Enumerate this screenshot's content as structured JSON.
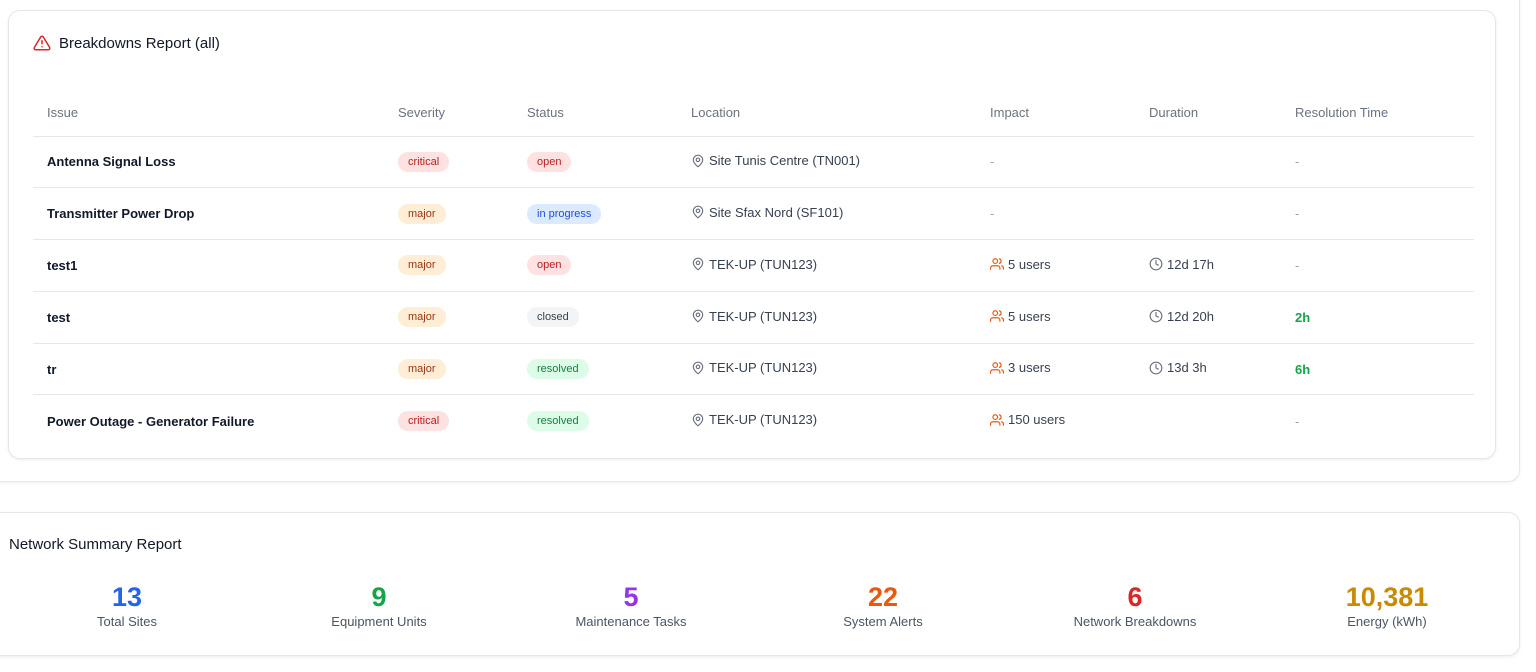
{
  "breakdowns": {
    "title": "Breakdowns Report (all)",
    "columns": [
      "Issue",
      "Severity",
      "Status",
      "Location",
      "Impact",
      "Duration",
      "Resolution Time"
    ],
    "rows": [
      {
        "issue": "Antenna Signal Loss",
        "severity": "critical",
        "status": "open",
        "location": "Site Tunis Centre (TN001)",
        "impact": "-",
        "duration": "",
        "resolution": "-"
      },
      {
        "issue": "Transmitter Power Drop",
        "severity": "major",
        "status": "in progress",
        "location": "Site Sfax Nord (SF101)",
        "impact": "-",
        "duration": "",
        "resolution": "-"
      },
      {
        "issue": "test1",
        "severity": "major",
        "status": "open",
        "location": "TEK-UP (TUN123)",
        "impact": "5 users",
        "duration": "12d 17h",
        "resolution": "-"
      },
      {
        "issue": "test",
        "severity": "major",
        "status": "closed",
        "location": "TEK-UP (TUN123)",
        "impact": "5 users",
        "duration": "12d 20h",
        "resolution": "2h"
      },
      {
        "issue": "tr",
        "severity": "major",
        "status": "resolved",
        "location": "TEK-UP (TUN123)",
        "impact": "3 users",
        "duration": "13d 3h",
        "resolution": "6h"
      },
      {
        "issue": "Power Outage - Generator Failure",
        "severity": "critical",
        "status": "resolved",
        "location": "TEK-UP (TUN123)",
        "impact": "150 users",
        "duration": "",
        "resolution": "-"
      }
    ]
  },
  "summary": {
    "title": "Network Summary Report",
    "stats": [
      {
        "value": "13",
        "label": "Total Sites",
        "color": "#2563eb"
      },
      {
        "value": "9",
        "label": "Equipment Units",
        "color": "#16a34a"
      },
      {
        "value": "5",
        "label": "Maintenance Tasks",
        "color": "#9333ea"
      },
      {
        "value": "22",
        "label": "System Alerts",
        "color": "#ea580c"
      },
      {
        "value": "6",
        "label": "Network Breakdowns",
        "color": "#dc2626"
      },
      {
        "value": "10,381",
        "label": "Energy (kWh)",
        "color": "#ca8a04"
      }
    ]
  },
  "icons": {
    "header": "warning-triangle-icon",
    "location": "map-pin-icon",
    "impact": "users-icon",
    "duration": "clock-icon"
  },
  "colors": {
    "warning": "#dc2626",
    "impact": "#ea580c",
    "resolution": "#16a34a"
  }
}
